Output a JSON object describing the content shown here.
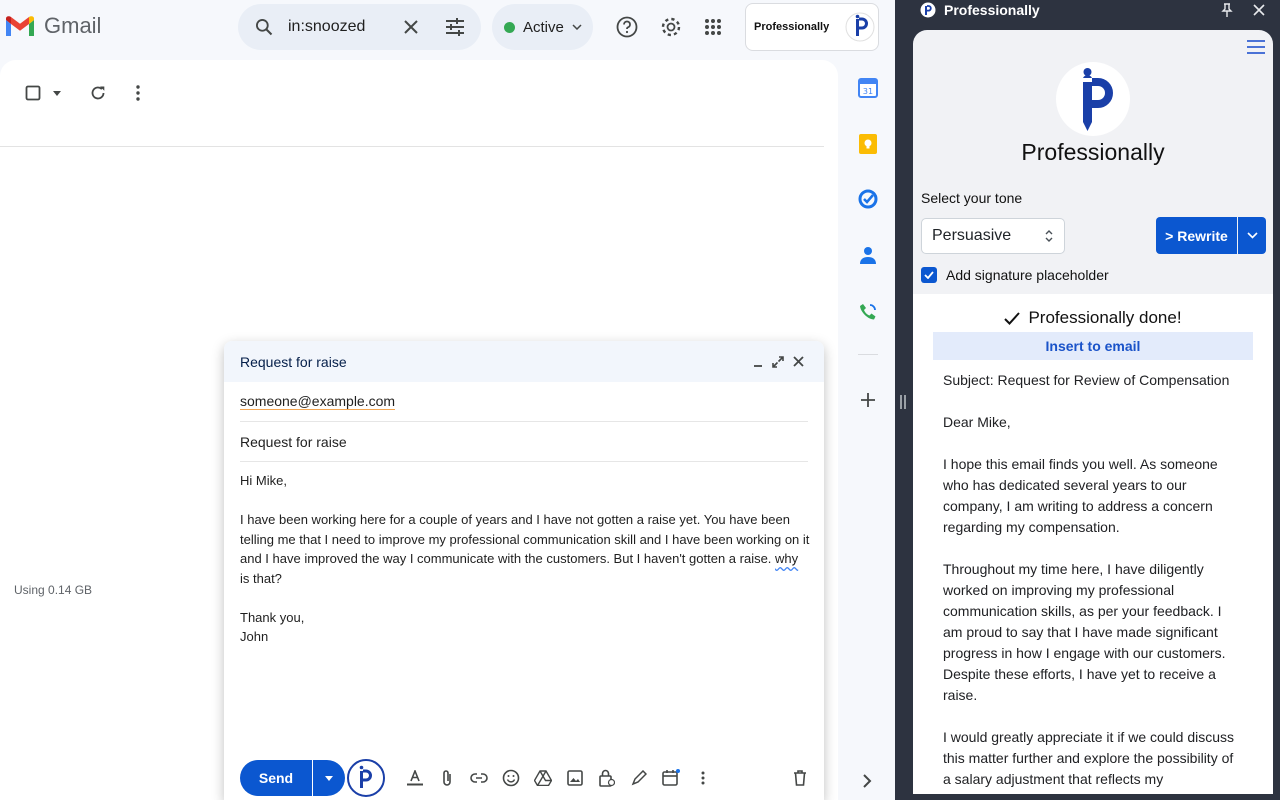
{
  "gmail": {
    "logo_text": "Gmail",
    "search_query": "in:snoozed",
    "status_label": "Active",
    "storage_text": "Using 0.14 GB"
  },
  "extension_card": {
    "label": "Professionally"
  },
  "compose": {
    "title": "Request for raise",
    "to": "someone@example.com",
    "subject": "Request for raise",
    "body": {
      "greeting": "Hi Mike,",
      "para1_a": "I have been working here for a couple of years and I have not gotten a raise yet. You have been telling me that I need to improve my professional communication skill and I have been working on it and I have improved the way I communicate with the customers. But I haven't gotten a raise.",
      "para1_why": "why",
      "para1_b": " is that?",
      "closing": "Thank you,",
      "name": "John"
    },
    "send_label": "Send"
  },
  "sidepanel": {
    "window_title": "Professionally",
    "brand": "Professionally",
    "tone_label": "Select your tone",
    "tone_value": "Persuasive",
    "rewrite_label": "> Rewrite",
    "signature_label": "Add signature placeholder",
    "signature_checked": true,
    "done_label": "Professionally done!",
    "insert_label": "Insert to email",
    "rewrite_paragraphs": [
      "Subject: Request for Review of Compensation",
      "Dear Mike,",
      "I hope this email finds you well. As someone who has dedicated several years to our company, I am writing to address a concern regarding my compensation.",
      "Throughout my time here, I have diligently worked on improving my professional communication skills, as per your feedback. I am proud to say that I have made significant progress in how I engage with our customers. Despite these efforts, I have yet to receive a raise.",
      "I would greatly appreciate it if we could discuss this matter further and explore the possibility of a salary adjustment that reflects my"
    ]
  },
  "colors": {
    "primary_blue": "#0b57d0",
    "status_green": "#34a853",
    "panel_dark": "#2d3340"
  }
}
